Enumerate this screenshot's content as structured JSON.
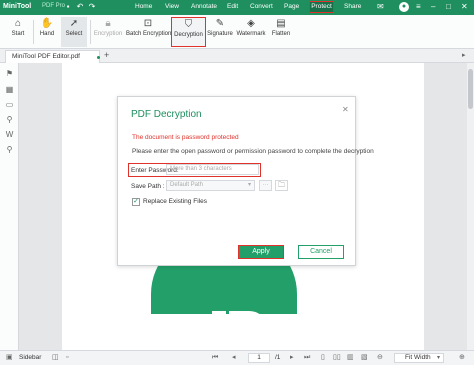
{
  "titlebar": {
    "app_name": "MiniTool",
    "app_edition": "PDF Pro",
    "menu": [
      "Home",
      "View",
      "Annotate",
      "Edit",
      "Convert",
      "Page"
    ],
    "active_menu": "Protect",
    "share": "Share"
  },
  "ribbon": {
    "start": "Start",
    "hand": "Hand",
    "select": "Select",
    "encryption": "Encryption",
    "batch_encryption": "Batch Encryption",
    "decryption": "Decryption",
    "signature": "Signature",
    "watermark": "Watermark",
    "flatten": "Flatten"
  },
  "tabs": {
    "doc_tab": "MiniTool PDF Editor.pdf",
    "add": "+"
  },
  "dialog": {
    "title": "PDF Decryption",
    "warning": "The document is password protected",
    "description": "Please enter the open password or permission password to complete the decryption",
    "password_label": "Enter Password:",
    "password_placeholder": "More than 3 characters",
    "save_path_label": "Save Path :",
    "save_path_value": "Default Path",
    "dots": "···",
    "replace_label": "Replace Existing Files",
    "replace_checked": true,
    "apply": "Apply",
    "cancel": "Cancel"
  },
  "statusbar": {
    "sidebar": "Sidebar",
    "current_page": "1",
    "total_pages": "/1",
    "zoom": "Fit Width"
  },
  "colors": {
    "brand": "#1f8f5f",
    "highlight": "#e0322b"
  }
}
